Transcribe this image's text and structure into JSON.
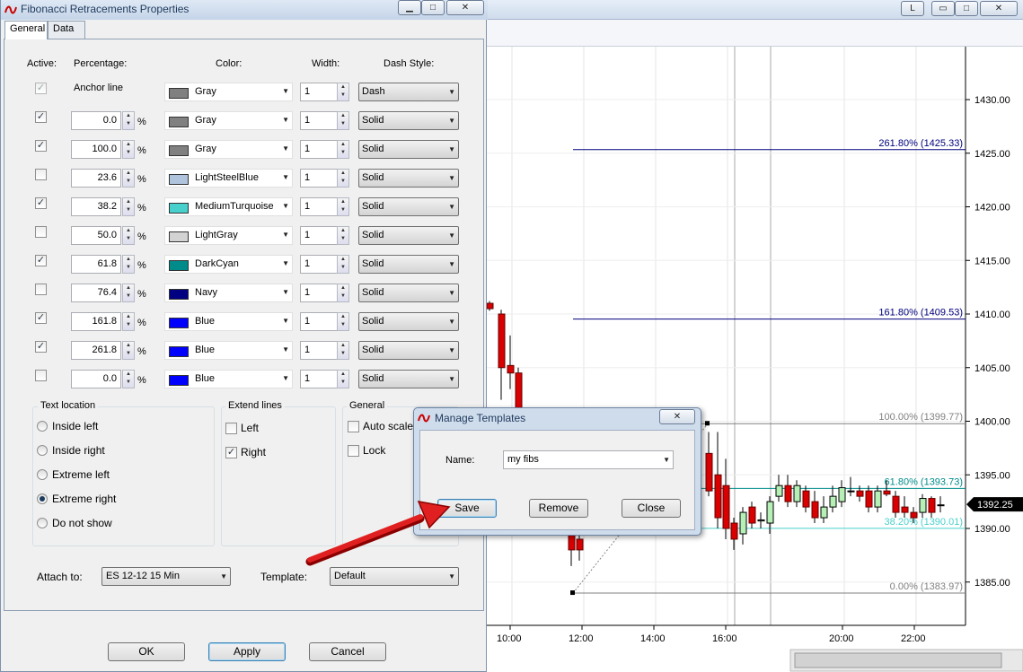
{
  "chart": {
    "window_buttons": {
      "l": "L",
      "min": "▭",
      "max": "□",
      "close": "✕"
    },
    "y_ticks": [
      "1430.00",
      "1425.00",
      "1420.00",
      "1415.00",
      "1410.00",
      "1405.00",
      "1400.00",
      "1395.00",
      "1390.00",
      "1385.00"
    ],
    "x_ticks": [
      "10:00",
      "12:00",
      "14:00",
      "16:00",
      "20:00",
      "22:00"
    ],
    "price_marker": "1392.25",
    "fib_labels": [
      "261.80% (1425.33)",
      "161.80% (1409.53)",
      "100.00% (1399.77)",
      "61.80% (1393.73)",
      "38.20% (1390.01)",
      "0.00% (1383.97)"
    ],
    "colors": {
      "navy": "#00007f",
      "teal": "#008b8b",
      "turq": "#48d1cc",
      "gray": "#808080",
      "up": "#b7f0b7",
      "down": "#d80000"
    }
  },
  "dialog": {
    "title": "Fibonacci Retracements Properties",
    "tabs": [
      "General",
      "Data"
    ],
    "headers": {
      "active": "Active:",
      "percentage": "Percentage:",
      "color": "Color:",
      "width": "Width:",
      "dash": "Dash Style:"
    },
    "anchor": {
      "label": "Anchor line",
      "color_name": "Gray",
      "color_hex": "#808080",
      "width": "1",
      "dash": "Dash"
    },
    "levels": [
      {
        "checked": true,
        "value": "0.0",
        "color_name": "Gray",
        "color_hex": "#808080",
        "width": "1",
        "dash": "Solid"
      },
      {
        "checked": true,
        "value": "100.0",
        "color_name": "Gray",
        "color_hex": "#808080",
        "width": "1",
        "dash": "Solid"
      },
      {
        "checked": false,
        "value": "23.6",
        "color_name": "LightSteelBlue",
        "color_hex": "#b0c4de",
        "width": "1",
        "dash": "Solid"
      },
      {
        "checked": true,
        "value": "38.2",
        "color_name": "MediumTurquoise",
        "color_hex": "#48d1cc",
        "width": "1",
        "dash": "Solid"
      },
      {
        "checked": false,
        "value": "50.0",
        "color_name": "LightGray",
        "color_hex": "#d3d3d3",
        "width": "1",
        "dash": "Solid"
      },
      {
        "checked": true,
        "value": "61.8",
        "color_name": "DarkCyan",
        "color_hex": "#008b8b",
        "width": "1",
        "dash": "Solid"
      },
      {
        "checked": false,
        "value": "76.4",
        "color_name": "Navy",
        "color_hex": "#000080",
        "width": "1",
        "dash": "Solid"
      },
      {
        "checked": true,
        "value": "161.8",
        "color_name": "Blue",
        "color_hex": "#0000ff",
        "width": "1",
        "dash": "Solid"
      },
      {
        "checked": true,
        "value": "261.8",
        "color_name": "Blue",
        "color_hex": "#0000ff",
        "width": "1",
        "dash": "Solid"
      },
      {
        "checked": false,
        "value": "0.0",
        "color_name": "Blue",
        "color_hex": "#0000ff",
        "width": "1",
        "dash": "Solid"
      }
    ],
    "percent_sign": "%",
    "text_location": {
      "title": "Text location",
      "options": [
        "Inside left",
        "Inside right",
        "Extreme left",
        "Extreme right",
        "Do not show"
      ],
      "selected": "Extreme right"
    },
    "extend_lines": {
      "title": "Extend lines",
      "left": "Left",
      "right": "Right",
      "left_checked": false,
      "right_checked": true
    },
    "general": {
      "title": "General",
      "auto_scale": "Auto scale",
      "lock": "Lock"
    },
    "attach_label": "Attach to:",
    "attach_value": "ES 12-12 15 Min",
    "template_label": "Template:",
    "template_value": "Default",
    "ok": "OK",
    "apply": "Apply",
    "cancel": "Cancel"
  },
  "manage": {
    "title": "Manage Templates",
    "name_label": "Name:",
    "name_value": "my fibs",
    "save": "Save",
    "remove": "Remove",
    "close": "Close",
    "close_icon": "✕"
  }
}
